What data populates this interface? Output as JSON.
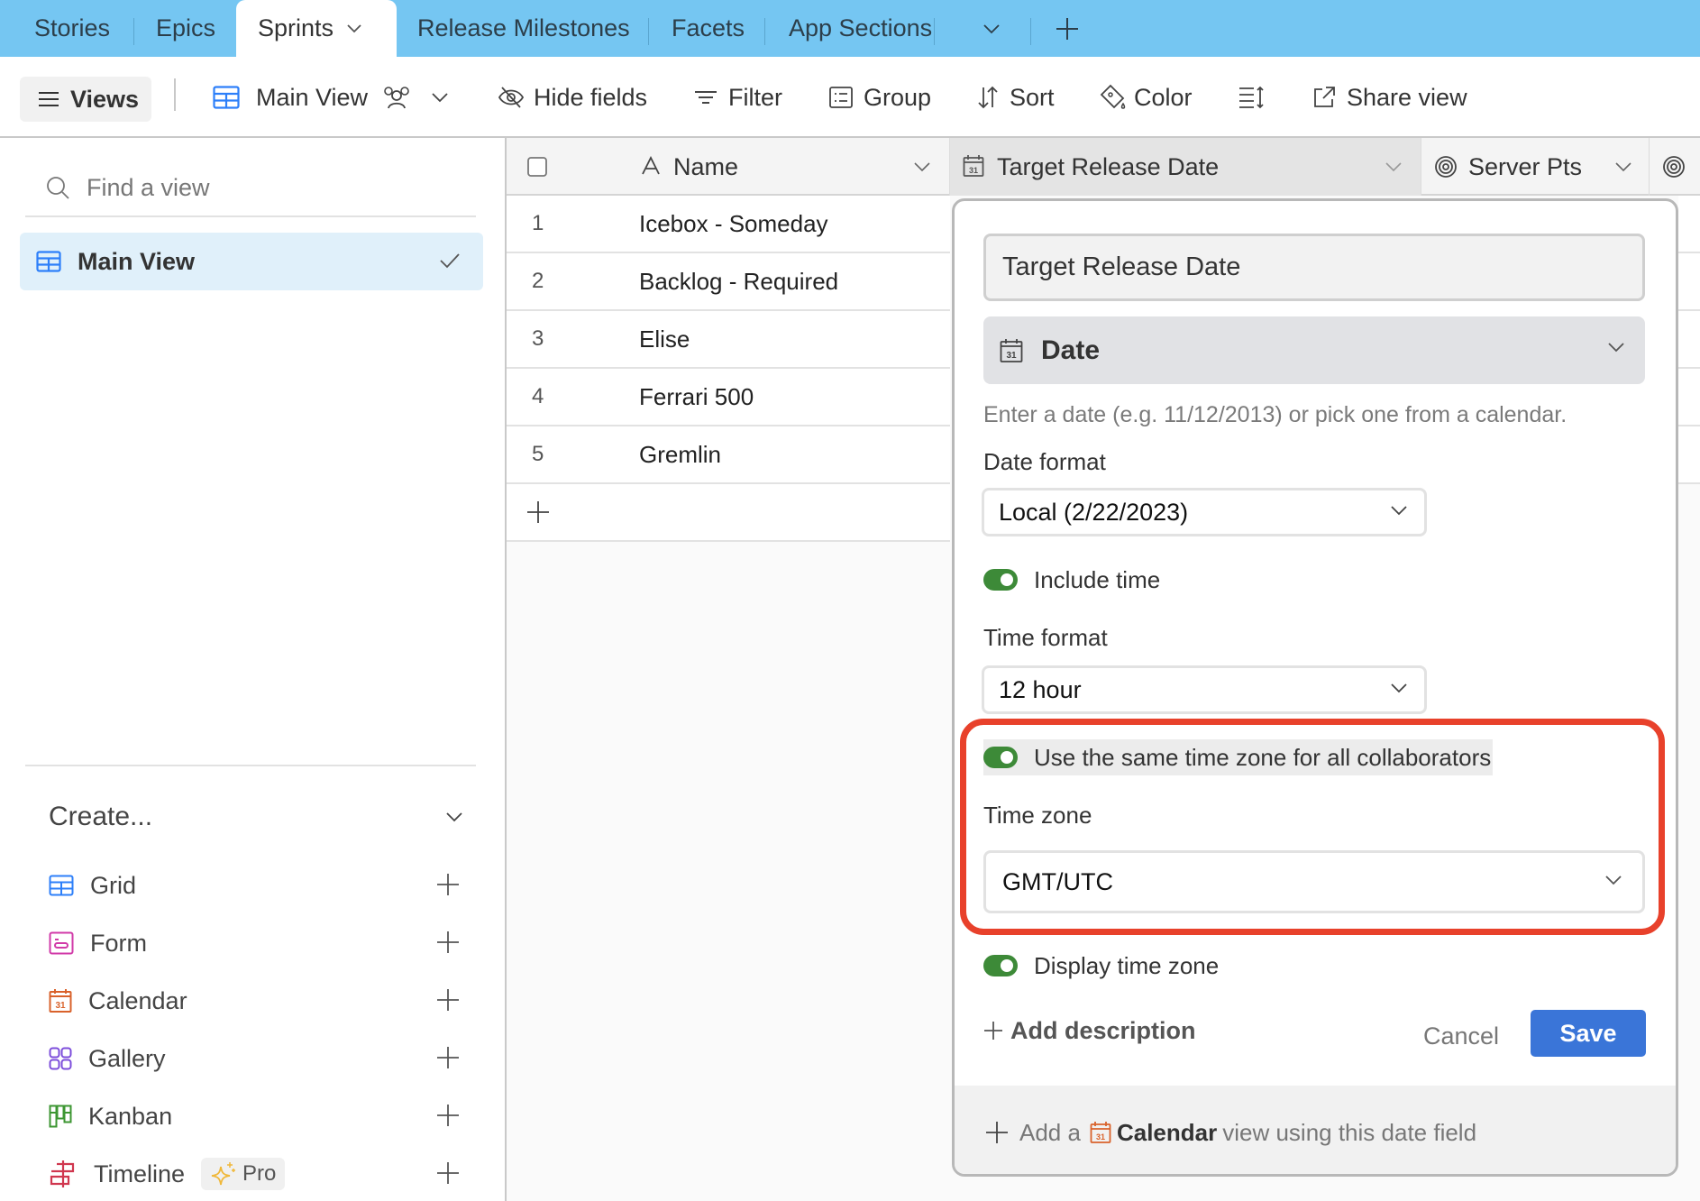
{
  "tabs": {
    "items": [
      {
        "label": "Stories",
        "active": false
      },
      {
        "label": "Epics",
        "active": false
      },
      {
        "label": "Sprints",
        "active": true
      },
      {
        "label": "Release Milestones",
        "active": false
      },
      {
        "label": "Facets",
        "active": false
      },
      {
        "label": "App Sections",
        "active": false
      }
    ],
    "more_icon": "chevron-down-icon",
    "add_icon": "plus-icon"
  },
  "toolbar": {
    "views_label": "Views",
    "view_name": "Main View",
    "hide_fields": "Hide fields",
    "filter": "Filter",
    "group": "Group",
    "sort": "Sort",
    "color": "Color",
    "share_view": "Share view"
  },
  "sidebar": {
    "search_placeholder": "Find a view",
    "views": [
      {
        "label": "Main View",
        "selected": true
      }
    ],
    "create_heading": "Create...",
    "create_items": [
      {
        "label": "Grid",
        "icon": "grid-icon",
        "color": "#2d7ff9"
      },
      {
        "label": "Form",
        "icon": "form-icon",
        "color": "#d13aa8"
      },
      {
        "label": "Calendar",
        "icon": "calendar-icon",
        "color": "#d9622b"
      },
      {
        "label": "Gallery",
        "icon": "gallery-icon",
        "color": "#7c4ddb"
      },
      {
        "label": "Kanban",
        "icon": "kanban-icon",
        "color": "#3c9632"
      },
      {
        "label": "Timeline",
        "icon": "timeline-icon",
        "color": "#d0374f",
        "badge": "Pro"
      }
    ]
  },
  "grid": {
    "columns": [
      {
        "label": "Name",
        "icon": "text-field-icon"
      },
      {
        "label": "Target Release Date",
        "icon": "calendar-icon"
      },
      {
        "label": "Server Pts",
        "icon": "rollup-spiral-icon"
      }
    ],
    "rows": [
      {
        "num": "1",
        "name": "Icebox - Someday"
      },
      {
        "num": "2",
        "name": "Backlog - Required"
      },
      {
        "num": "3",
        "name": "Elise"
      },
      {
        "num": "4",
        "name": "Ferrari 500"
      },
      {
        "num": "5",
        "name": "Gremlin"
      }
    ]
  },
  "field_editor": {
    "field_name": "Target Release Date",
    "field_type": "Date",
    "hint": "Enter a date (e.g. 11/12/2013) or pick one from a calendar.",
    "date_format_label": "Date format",
    "date_format_value": "Local (2/22/2023)",
    "include_time_label": "Include time",
    "include_time_on": true,
    "time_format_label": "Time format",
    "time_format_value": "12 hour",
    "same_tz_label": "Use the same time zone for all collaborators",
    "same_tz_on": true,
    "time_zone_label": "Time zone",
    "time_zone_value": "GMT/UTC",
    "display_tz_label": "Display time zone",
    "display_tz_on": true,
    "add_description": "Add description",
    "cancel": "Cancel",
    "save": "Save",
    "footer_prefix": "Add a",
    "footer_bold": "Calendar",
    "footer_suffix": "view using this date field",
    "accent_color": "#3a75d8",
    "toggle_color": "#3d8a38",
    "highlight_color": "#e8412b"
  }
}
